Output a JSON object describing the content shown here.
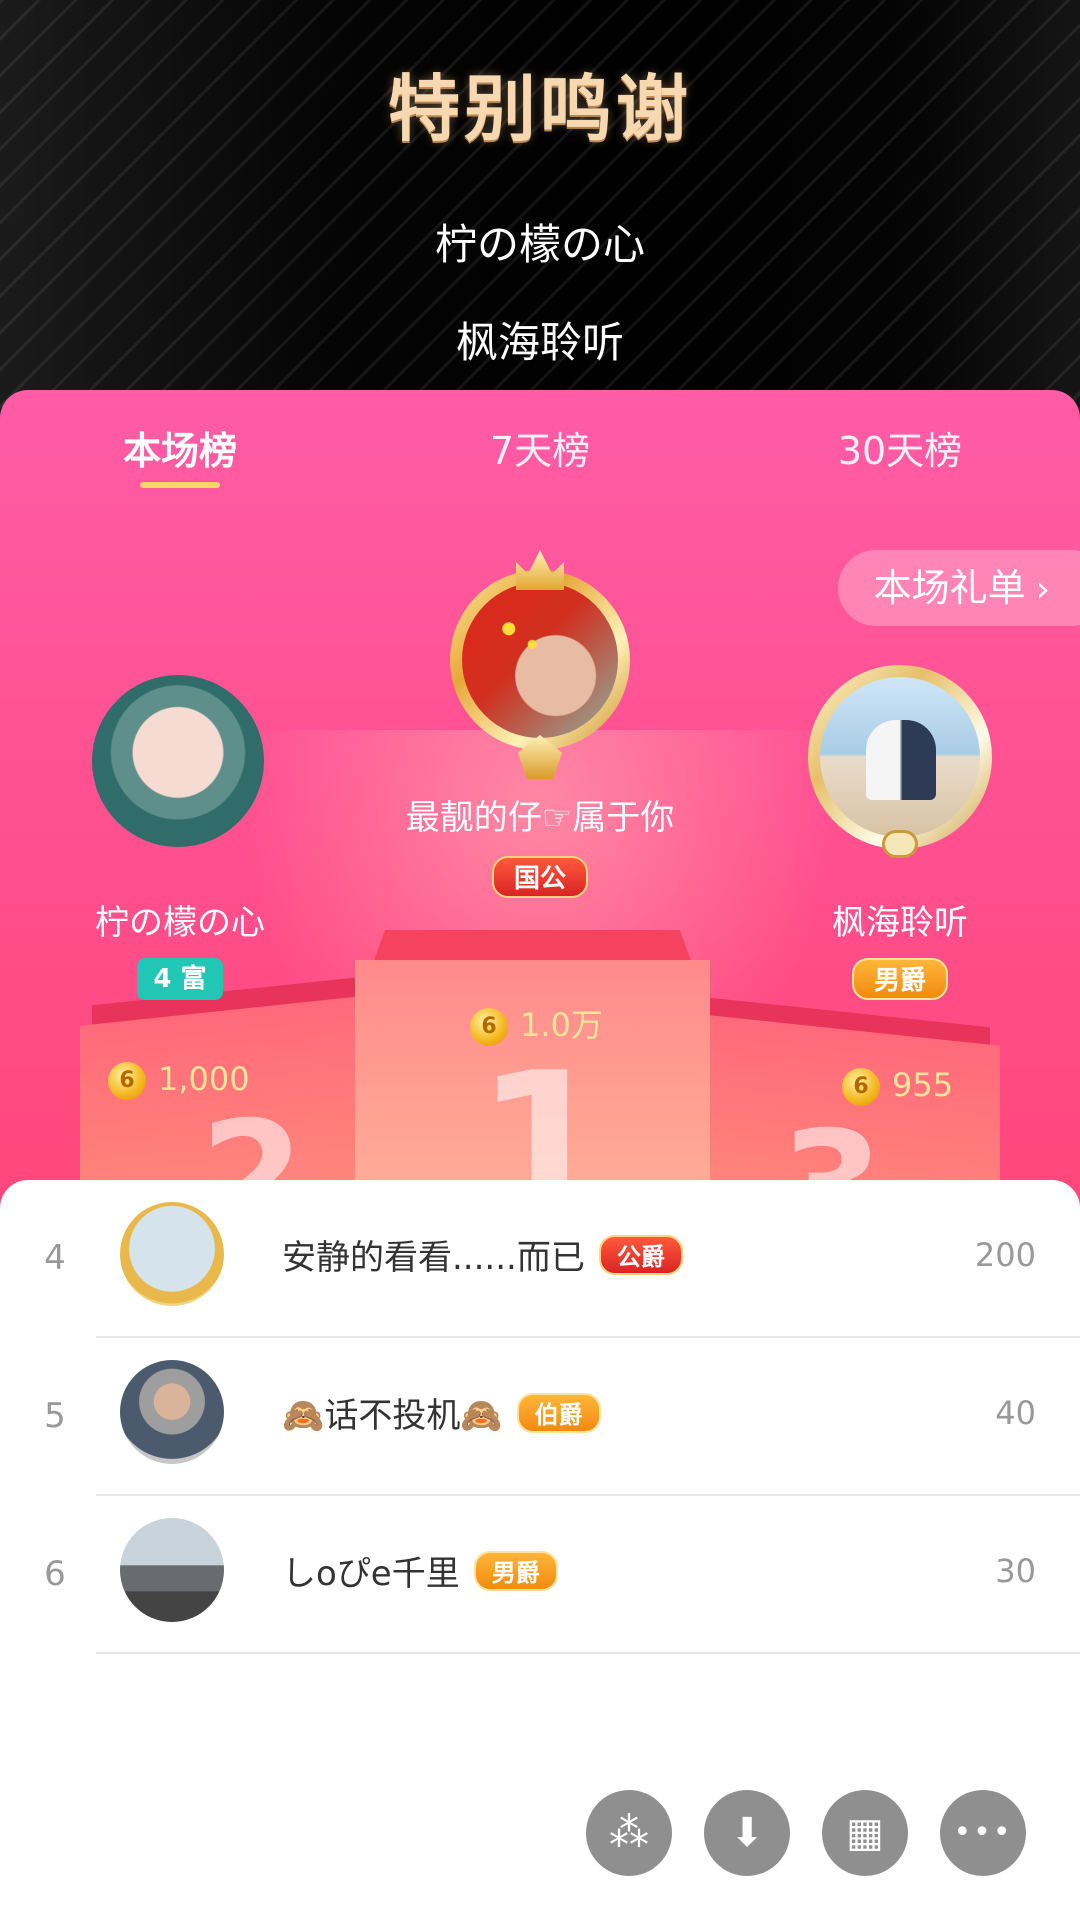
{
  "header": {
    "title": "特别鸣谢",
    "credits": [
      "柠の檬の心",
      "枫海聆听"
    ]
  },
  "tabs": [
    {
      "label": "本场榜",
      "active": true
    },
    {
      "label": "7天榜",
      "active": false
    },
    {
      "label": "30天榜",
      "active": false
    }
  ],
  "gift_list_button": {
    "label": "本场礼单",
    "icon": "chevron-right-icon"
  },
  "podium": {
    "first": {
      "name": "最靓的仔☞属于你",
      "badge": "国公",
      "score": "1.0万",
      "rank_number": "1"
    },
    "second": {
      "name": "柠の檬の心",
      "badge": "4 富",
      "score": "1,000",
      "rank_number": "2"
    },
    "third": {
      "name": "枫海聆听",
      "badge": "男爵",
      "score": "955",
      "rank_number": "3"
    }
  },
  "coin_symbol": "6",
  "list": [
    {
      "rank": "4",
      "name": "安静的看看......而已",
      "badge": "公爵",
      "value": "200"
    },
    {
      "rank": "5",
      "name": "🙈话不投机🙈",
      "badge": "伯爵",
      "value": "40"
    },
    {
      "rank": "6",
      "name": "しoぴe千里",
      "badge": "男爵",
      "value": "30"
    }
  ],
  "actions": [
    {
      "icon": "sparkle-icon",
      "glyph": "⁂"
    },
    {
      "icon": "download-icon",
      "glyph": "⬇"
    },
    {
      "icon": "grid-icon",
      "glyph": "▦"
    },
    {
      "icon": "more-icon",
      "glyph": "•••"
    }
  ],
  "colors": {
    "panel_pink": "#ff4f8e",
    "tab_underline": "#ffd46b",
    "title_gold": "#f7d8b0"
  }
}
